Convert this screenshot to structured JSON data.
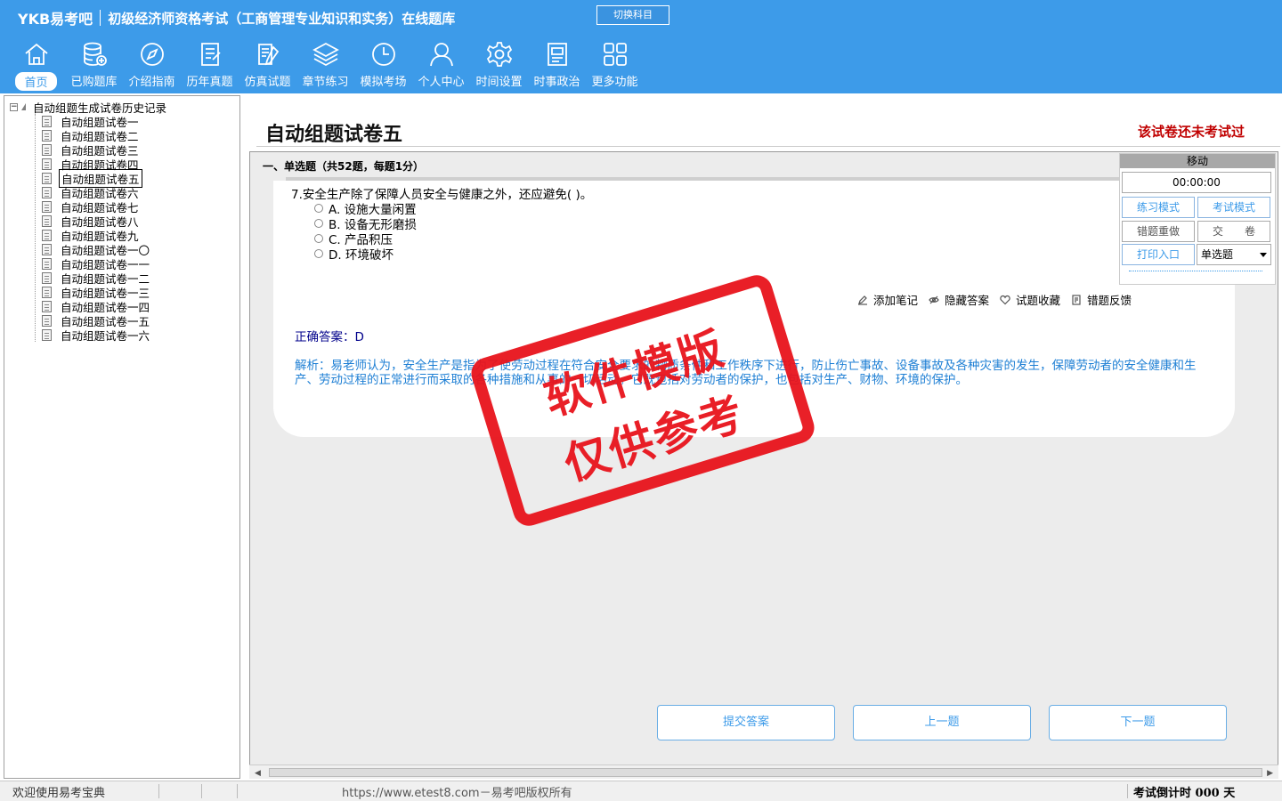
{
  "header": {
    "logo": "YKB易考吧",
    "title": "初级经济师资格考试（工商管理专业知识和实务）在线题库",
    "switch_subject": "切换科目"
  },
  "toolbar": [
    {
      "label": "首页",
      "icon": "home-icon",
      "active": true
    },
    {
      "label": "已购题库",
      "icon": "database-icon"
    },
    {
      "label": "介绍指南",
      "icon": "compass-icon"
    },
    {
      "label": "历年真题",
      "icon": "document-list-icon"
    },
    {
      "label": "仿真试题",
      "icon": "document-edit-icon"
    },
    {
      "label": "章节练习",
      "icon": "layers-icon"
    },
    {
      "label": "模拟考场",
      "icon": "clock-icon"
    },
    {
      "label": "个人中心",
      "icon": "user-icon"
    },
    {
      "label": "时间设置",
      "icon": "gear-icon"
    },
    {
      "label": "时事政治",
      "icon": "newspaper-icon"
    },
    {
      "label": "更多功能",
      "icon": "grid-icon"
    }
  ],
  "tree": {
    "root": "自动组题生成试卷历史记录",
    "items": [
      "自动组题试卷一",
      "自动组题试卷二",
      "自动组题试卷三",
      "自动组题试卷四",
      "自动组题试卷五",
      "自动组题试卷六",
      "自动组题试卷七",
      "自动组题试卷八",
      "自动组题试卷九",
      "自动组题试卷一〇",
      "自动组题试卷一一",
      "自动组题试卷一二",
      "自动组题试卷一三",
      "自动组题试卷一四",
      "自动组题试卷一五",
      "自动组题试卷一六"
    ],
    "selected_index": 4
  },
  "main": {
    "paper_title": "自动组题试卷五",
    "status_note": "该试卷还未考试过",
    "section_heading": "一、单选题（共52题，每题1分）",
    "question": "7.安全生产除了保障人员安全与健康之外，还应避免( )。",
    "options": [
      "A. 设施大量闲置",
      "B. 设备无形磨损",
      "C. 产品积压",
      "D. 环境破坏"
    ],
    "actions": [
      "添加笔记",
      "隐藏答案",
      "试题收藏",
      "错题反馈"
    ],
    "answer": "正确答案：D",
    "analysis": "解析：易老师认为，安全生产是指为了使劳动过程在符合安全要求的物质条件和工作秩序下进行，防止伤亡事故、设备事故及各种灾害的发生，保障劳动者的安全健康和生产、劳动过程的正常进行而采取的各种措施和从事的一切活动。它既包括对劳动者的保护，也包括对生产、财物、环境的保护。",
    "submit": "提交答案",
    "prev": "上一题",
    "next": "下一题"
  },
  "sidepanel": {
    "move": "移动",
    "timer": "00:00:00",
    "practice_mode": "练习模式",
    "exam_mode": "考试模式",
    "redo_wrong": "错题重做",
    "hand_in": "交　　卷",
    "print": "打印入口",
    "qtype": "单选题"
  },
  "statusbar": {
    "welcome": "欢迎使用易考宝典",
    "copyright": "https://www.etest8.com－易考吧版权所有",
    "countdown": "考试倒计时 000 天"
  },
  "watermark": {
    "line1": "软件模版",
    "line2": "仅供参考"
  },
  "colors": {
    "header_blue": "#3d9be9",
    "stamp_red": "#e8141c",
    "note_red": "#c00000",
    "analysis_blue": "#1e7fd4"
  }
}
